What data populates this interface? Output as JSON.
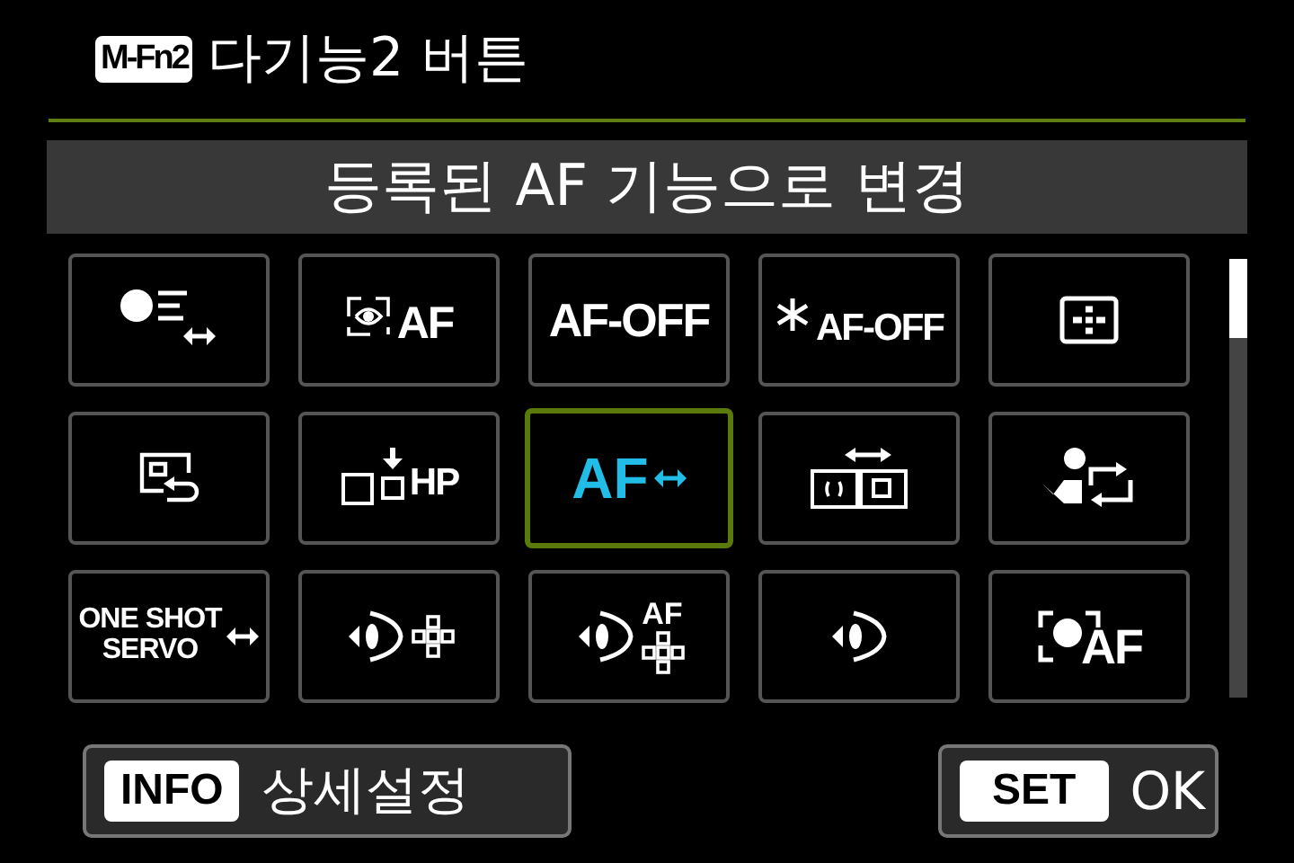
{
  "header": {
    "badge": "M-Fn2",
    "title": "다기능2 버튼"
  },
  "subtitle": "등록된 AF 기능으로 변경",
  "functions": [
    {
      "kind": "metering-switch",
      "selected": false
    },
    {
      "kind": "camera-af",
      "labels": [
        "AF"
      ],
      "selected": false
    },
    {
      "kind": "text",
      "labels": [
        "AF-OFF"
      ],
      "selected": false
    },
    {
      "kind": "star-text",
      "labels": [
        "AF-OFF"
      ],
      "selected": false
    },
    {
      "kind": "af-point",
      "selected": false
    },
    {
      "kind": "recall",
      "selected": false
    },
    {
      "kind": "home-position",
      "labels": [
        "HP"
      ],
      "selected": false
    },
    {
      "kind": "af-switch",
      "labels": [
        "AF"
      ],
      "selected": true
    },
    {
      "kind": "area-switch",
      "selected": false
    },
    {
      "kind": "tracking",
      "selected": false
    },
    {
      "kind": "mode-switch",
      "labels": [
        "ONE SHOT",
        "SERVO"
      ],
      "selected": false
    },
    {
      "kind": "eye-points",
      "selected": false
    },
    {
      "kind": "eye-af-points",
      "labels": [
        "AF"
      ],
      "selected": false
    },
    {
      "kind": "eye",
      "selected": false
    },
    {
      "kind": "face-af",
      "labels": [
        "AF"
      ],
      "selected": false
    }
  ],
  "footer": {
    "info": {
      "key": "INFO",
      "label": "상세설정"
    },
    "set": {
      "key": "SET",
      "label": "OK"
    }
  }
}
